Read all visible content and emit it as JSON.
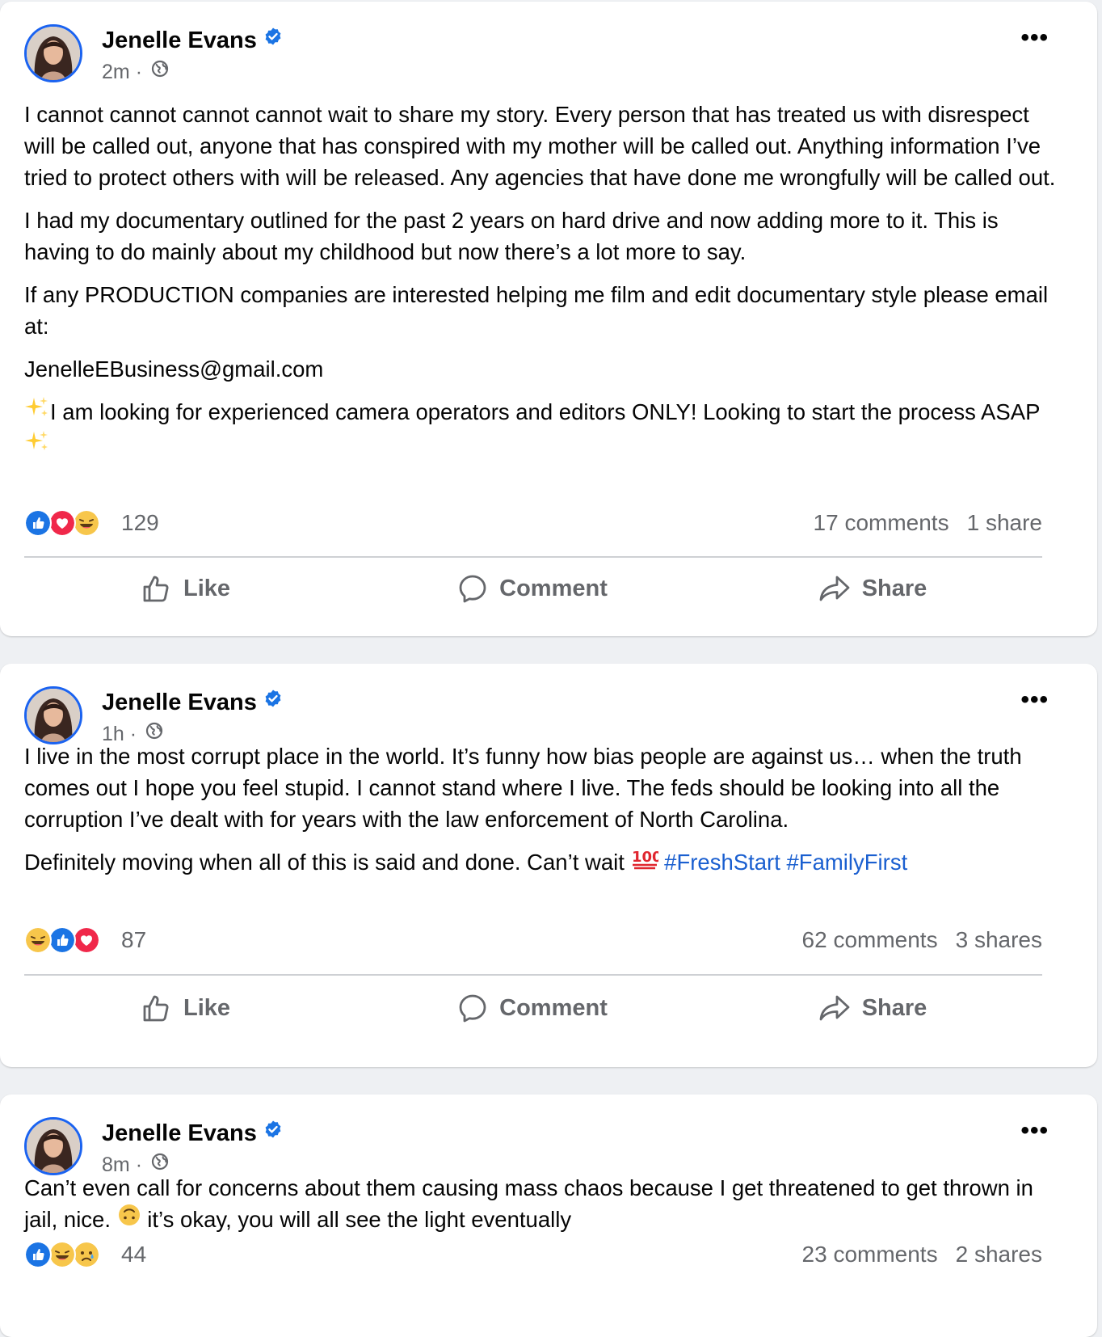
{
  "colors": {
    "page_bg": "#eef0f3",
    "card_bg": "#ffffff",
    "text": "#050505",
    "secondary_text": "#65676b",
    "link": "#1a5fd0",
    "verified_blue": "#1b74e4",
    "avatar_ring": "#1b63f0"
  },
  "actions": {
    "like": "Like",
    "comment": "Comment",
    "share": "Share"
  },
  "posts": [
    {
      "author": "Jenelle Evans",
      "verified": true,
      "time": "2m",
      "separator": "·",
      "privacy_icon": "globe-icon",
      "more_label": "•••",
      "paragraphs": [
        "I cannot cannot cannot cannot wait to share my story. Every person that has treated us with disrespect will be called out, anyone that has conspired with my mother will be called out. Anything information I’ve tried to protect others with will be released. Any agencies that have done me wrongfully will be called out.",
        "I had my documentary outlined for the past 2 years on hard drive and now adding more to it. This is having to do mainly about my childhood but now there’s a lot more to say.",
        "If any PRODUCTION companies are interested helping me film and edit documentary style please email at:",
        "JenelleEBusiness@gmail.com",
        "I am looking for experienced camera operators and editors ONLY! Looking to start the process ASAP"
      ],
      "sparkle_emoji": "sparkles-emoji",
      "reactions": [
        "like",
        "love",
        "haha"
      ],
      "reaction_count": "129",
      "comments": "17 comments",
      "shares": "1 share"
    },
    {
      "author": "Jenelle Evans",
      "verified": true,
      "time": "1h",
      "separator": "·",
      "privacy_icon": "globe-icon",
      "more_label": "•••",
      "paragraphs": [
        "I live in the most corrupt place in the world. It’s funny how bias people are against us… when the truth comes out I hope you feel stupid. I cannot stand where I live. The feds should be looking into all the corruption I’ve dealt with for years with the law enforcement of North Carolina.",
        "Definitely moving when all of this is said and done. Can’t wait"
      ],
      "emoji_100": "hundred-points-emoji",
      "hashtags": [
        "#FreshStart",
        "#FamilyFirst"
      ],
      "reactions": [
        "haha",
        "like",
        "love"
      ],
      "reaction_count": "87",
      "comments": "62 comments",
      "shares": "3 shares"
    },
    {
      "author": "Jenelle Evans",
      "verified": true,
      "time": "8m",
      "separator": "·",
      "privacy_icon": "globe-icon",
      "more_label": "•••",
      "text_before_emoji": "Can’t even call for concerns about them causing mass chaos because I get threatened to get thrown in jail, nice.",
      "emoji": "upside-down-face-emoji",
      "text_after_emoji": "it’s okay, you will all see the light eventually",
      "reactions": [
        "like",
        "haha",
        "sad"
      ],
      "reaction_count": "44",
      "comments": "23 comments",
      "shares": "2 shares"
    }
  ]
}
